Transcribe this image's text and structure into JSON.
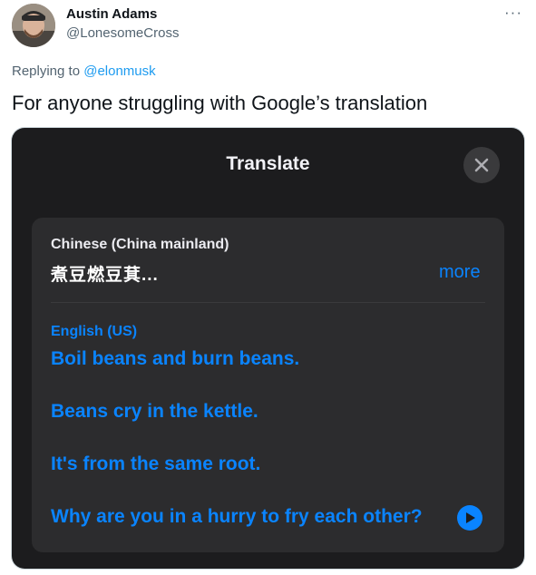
{
  "tweet": {
    "author_name": "Austin Adams",
    "author_handle": "@LonesomeCross",
    "more_label": "···",
    "replying_prefix": "Replying to",
    "replying_to": "@elonmusk",
    "text": "For anyone struggling with Google’s translation"
  },
  "translate": {
    "title": "Translate",
    "source_language": "Chinese (China mainland)",
    "source_text": "煮豆燃豆萁...",
    "more_label": "more",
    "target_language": "English (US)",
    "lines": [
      "Boil beans and burn beans.",
      "Beans cry in the kettle.",
      "It's from the same root.",
      "Why are you in a hurry to fry each other?"
    ]
  },
  "icons": {
    "close": "close-icon",
    "play": "play-icon",
    "more": "more-horizontal-icon"
  },
  "colors": {
    "link": "#1d9bf0",
    "ios_blue": "#0a84ff",
    "sheet_bg": "#1c1c1e",
    "card_bg": "#2c2c2e"
  }
}
